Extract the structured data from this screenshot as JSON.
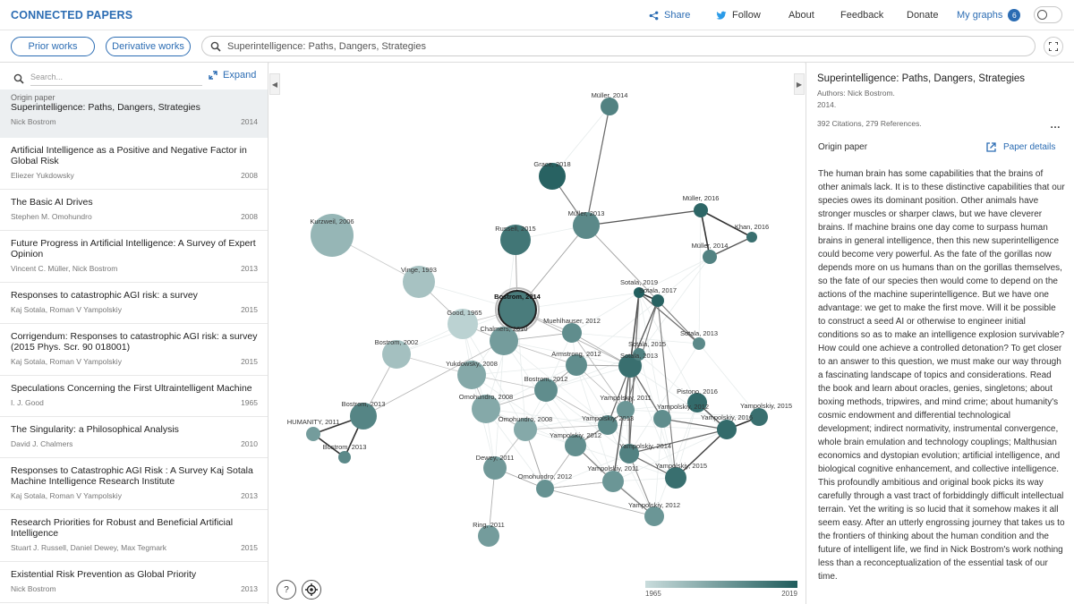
{
  "app": {
    "logo": "CONNECTED PAPERS"
  },
  "nav": {
    "share": "Share",
    "follow": "Follow",
    "about": "About",
    "feedback": "Feedback",
    "donate": "Donate",
    "my_graphs": "My graphs",
    "my_graphs_count": "6"
  },
  "toolbar": {
    "prior_works": "Prior works",
    "derivative_works": "Derivative works",
    "search_value": "Superintelligence: Paths, Dangers, Strategies"
  },
  "left": {
    "search_placeholder": "Search...",
    "expand": "Expand",
    "origin": {
      "label": "Origin paper",
      "title": "Superintelligence: Paths, Dangers, Strategies",
      "authors": "Nick Bostrom",
      "year": "2014"
    },
    "papers": [
      {
        "title": "Artificial Intelligence as a Positive and Negative Factor in Global Risk",
        "authors": "Eliezer Yukdowsky",
        "year": "2008"
      },
      {
        "title": "The Basic AI Drives",
        "authors": "Stephen M. Omohundro",
        "year": "2008"
      },
      {
        "title": "Future Progress in Artificial Intelligence: A Survey of Expert Opinion",
        "authors": "Vincent C. Müller, Nick Bostrom",
        "year": "2013"
      },
      {
        "title": "Responses to catastrophic AGI risk: a survey",
        "authors": "Kaj Sotala, Roman V Yampolskiy",
        "year": "2015"
      },
      {
        "title": "Corrigendum: Responses to catastrophic AGI risk: a survey (2015 Phys. Scr. 90 018001)",
        "authors": "Kaj Sotala, Roman V Yampolskiy",
        "year": "2015"
      },
      {
        "title": "Speculations Concerning the First Ultraintelligent Machine",
        "authors": "I. J. Good",
        "year": "1965"
      },
      {
        "title": "The Singularity: a Philosophical Analysis",
        "authors": "David J. Chalmers",
        "year": "2010"
      },
      {
        "title": "Responses to Catastrophic AGI Risk : A Survey Kaj Sotala Machine Intelligence Research Institute",
        "authors": "Kaj Sotala, Roman V Yampolskiy",
        "year": "2013"
      },
      {
        "title": "Research Priorities for Robust and Beneficial Artificial Intelligence",
        "authors": "Stuart J. Russell, Daniel Dewey, Max Tegmark",
        "year": "2015"
      },
      {
        "title": "Existential Risk Prevention as Global Priority",
        "authors": "Nick Bostrom",
        "year": "2013"
      }
    ]
  },
  "graph": {
    "legend_min": "1965",
    "legend_max": "2019",
    "color_old": "#c9dcdc",
    "color_new": "#1f5c5c",
    "selected_label": "Bostrom, 2014",
    "nodes": [
      {
        "id": "muller2014a",
        "label": "Müller, 2014"
      },
      {
        "id": "grace2018",
        "label": "Grace, 2018"
      },
      {
        "id": "muller2013",
        "label": "Müller, 2013"
      },
      {
        "id": "russell2015",
        "label": "Russell, 2015"
      },
      {
        "id": "kurzweil2006",
        "label": "Kurzweil, 2006"
      },
      {
        "id": "muller2016",
        "label": "Müller, 2016"
      },
      {
        "id": "khan2016",
        "label": "Khan, 2016"
      },
      {
        "id": "muller2014b",
        "label": "Müller, 2014"
      },
      {
        "id": "vinge1993",
        "label": "Vinge, 1993"
      },
      {
        "id": "bostrom2014",
        "label": "Bostrom, 2014"
      },
      {
        "id": "sotala2019",
        "label": "Sotala, 2019"
      },
      {
        "id": "sotala2017",
        "label": "Sotala, 2017"
      },
      {
        "id": "good1965",
        "label": "Good, 1965"
      },
      {
        "id": "chalmers2010",
        "label": "Chalmers, 2010"
      },
      {
        "id": "muehlhauser2012",
        "label": "Muehlhauser, 2012"
      },
      {
        "id": "sotala2013",
        "label": "Sotala, 2013"
      },
      {
        "id": "bostrom2002",
        "label": "Bostrom, 2002"
      },
      {
        "id": "sotala2015",
        "label": "Sotala, 2015"
      },
      {
        "id": "armstrong2012",
        "label": "Armstrong, 2012"
      },
      {
        "id": "yukdowsky2008",
        "label": "Yukdowsky, 2008"
      },
      {
        "id": "sotala2013b",
        "label": "Sotala, 2013"
      },
      {
        "id": "bostrom2012",
        "label": "Bostrom, 2012"
      },
      {
        "id": "omohundro2008a",
        "label": "Omohundro, 2008"
      },
      {
        "id": "pistono2016",
        "label": "Pistono, 2016"
      },
      {
        "id": "yampolskiy2011a",
        "label": "Yampolskiy, 2011"
      },
      {
        "id": "yampolskiy2015a",
        "label": "Yampolskiy, 2015"
      },
      {
        "id": "yampolskiy2013",
        "label": "Yampolskiy, 2013"
      },
      {
        "id": "bostrom2013a",
        "label": "Bostrom, 2013"
      },
      {
        "id": "omohundro2008b",
        "label": "Omohundro, 2008"
      },
      {
        "id": "yampolskiy2012a",
        "label": "Yampolskiy, 2012"
      },
      {
        "id": "yampolskiy2016",
        "label": "Yampolskiy, 2016"
      },
      {
        "id": "humanity2011",
        "label": "HUMANITY, 2011"
      },
      {
        "id": "yampolskiy2012b",
        "label": "Yampolskiy, 2012"
      },
      {
        "id": "bostrom2013b",
        "label": "Bostrom, 2013"
      },
      {
        "id": "yampolskiy2014",
        "label": "Yampolskiy, 2014"
      },
      {
        "id": "dewey2011",
        "label": "Dewey, 2011"
      },
      {
        "id": "yampolskiy2015b",
        "label": "Yampolskiy, 2015"
      },
      {
        "id": "yampolskiy2011b",
        "label": "Yampolskiy, 2011"
      },
      {
        "id": "omohundro2012",
        "label": "Omohundro, 2012"
      },
      {
        "id": "yampolskiy2012c",
        "label": "Yampolskiy, 2012"
      },
      {
        "id": "ring2011",
        "label": "Ring, 2011"
      }
    ]
  },
  "right": {
    "title": "Superintelligence: Paths, Dangers, Strategies",
    "authors": "Authors: Nick Bostrom.",
    "year": "2014.",
    "citations": "392 Citations, 279 References.",
    "origin_label": "Origin paper",
    "details": "Paper details",
    "abstract": "The human brain has some capabilities that the brains of other animals lack. It is to these distinctive capabilities that our species owes its dominant position. Other animals have stronger muscles or sharper claws, but we have cleverer brains. If machine brains one day come to surpass human brains in general intelligence, then this new superintelligence could become very powerful. As the fate of the gorillas now depends more on us humans than on the gorillas themselves, so the fate of our species then would come to depend on the actions of the machine superintelligence. But we have one advantage: we get to make the first move. Will it be possible to construct a seed AI or otherwise to engineer initial conditions so as to make an intelligence explosion survivable? How could one achieve a controlled detonation? To get closer to an answer to this question, we must make our way through a fascinating landscape of topics and considerations. Read the book and learn about oracles, genies, singletons; about boxing methods, tripwires, and mind crime; about humanity's cosmic endowment and differential technological development; indirect normativity, instrumental convergence, whole brain emulation and technology couplings; Malthusian economics and dystopian evolution; artificial intelligence, and biological cognitive enhancement, and collective intelligence. This profoundly ambitious and original book picks its way carefully through a vast tract of forbiddingly difficult intellectual terrain. Yet the writing is so lucid that it somehow makes it all seem easy. After an utterly engrossing journey that takes us to the frontiers of thinking about the human condition and the future of intelligent life, we find in Nick Bostrom's work nothing less than a reconceptualization of the essential task of our time."
  }
}
